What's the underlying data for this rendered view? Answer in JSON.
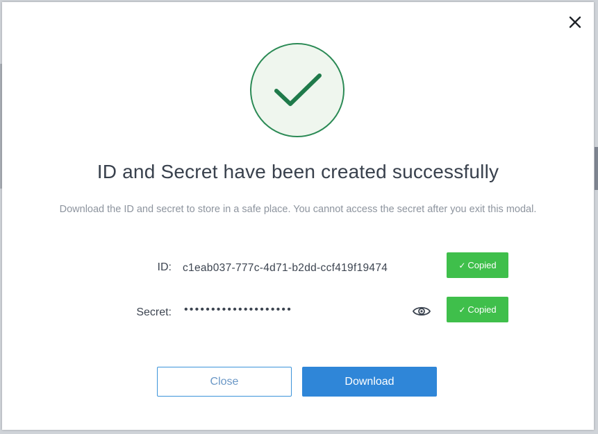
{
  "modal": {
    "title": "ID and Secret have been created successfully",
    "subtitle": "Download the ID and secret to store in a safe place. You cannot access the secret after you exit this modal.",
    "icons": {
      "close": "close-icon",
      "success": "checkmark-icon",
      "reveal": "eye-icon"
    },
    "id_field": {
      "label": "ID:",
      "value": "c1eab037-777c-4d71-b2dd-ccf419f19474",
      "copied_label": "Copied"
    },
    "secret_field": {
      "label": "Secret:",
      "value": "••••••••••••••••••••",
      "copied_label": "Copied"
    },
    "buttons": {
      "close_label": "Close",
      "download_label": "Download"
    }
  },
  "colors": {
    "success_green": "#2b8a55",
    "copied_green": "#3fbf4b",
    "primary_blue": "#2f86d8",
    "title_text": "#39414d",
    "muted_text": "#8d949e"
  }
}
